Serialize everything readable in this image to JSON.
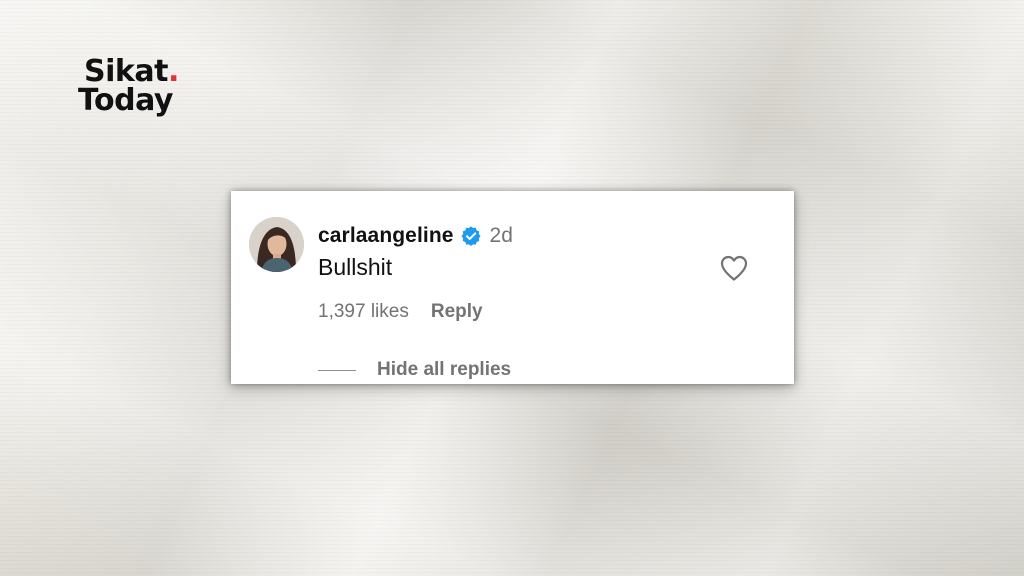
{
  "logo": {
    "line1": "Sikat",
    "dot": ".",
    "line2": "Today",
    "accent_color": "#e3342f"
  },
  "comment": {
    "avatar_icon": "profile-photo",
    "username": "carlaangeline",
    "verified_icon": "verified-badge-icon",
    "verified_color": "#1d9bf0",
    "timestamp": "2d",
    "text": "Bullshit",
    "like_icon": "heart-outline-icon",
    "likes": "1,397 likes",
    "reply_label": "Reply",
    "hide_replies_label": "Hide all replies"
  }
}
